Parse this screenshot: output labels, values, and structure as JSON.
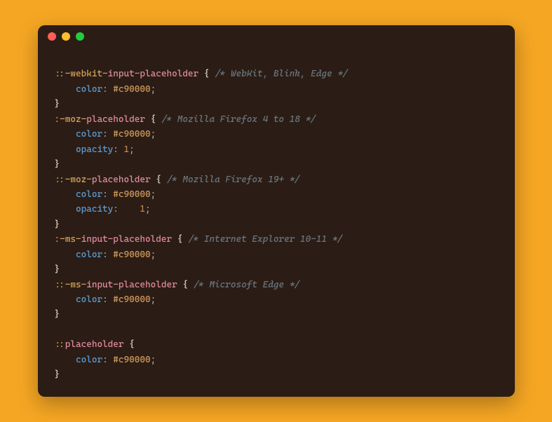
{
  "window": {
    "dots": [
      "red",
      "yellow",
      "green"
    ]
  },
  "code": {
    "lines": [
      {
        "t": "blank"
      },
      {
        "t": "sel",
        "parts": [
          "::-webkit-",
          "input-placeholder"
        ],
        "brace": " {",
        "comment": " /* WebKit, Blink, Edge */"
      },
      {
        "t": "prop",
        "indent": "    ",
        "name": "color",
        "sep": ": ",
        "value": "#c90000",
        "end": ";"
      },
      {
        "t": "close",
        "brace": "}"
      },
      {
        "t": "sel",
        "parts": [
          ":-moz-",
          "placeholder"
        ],
        "brace": " {",
        "comment": " /* Mozilla Firefox 4 to 18 */"
      },
      {
        "t": "prop",
        "indent": "    ",
        "name": "color",
        "sep": ": ",
        "value": "#c90000",
        "end": ";"
      },
      {
        "t": "propnum",
        "indent": "    ",
        "name": "opacity",
        "sep": ": ",
        "value": "1",
        "end": ";"
      },
      {
        "t": "close",
        "brace": "}"
      },
      {
        "t": "sel",
        "parts": [
          "::-moz-",
          "placeholder"
        ],
        "brace": " {",
        "comment": " /* Mozilla Firefox 19+ */"
      },
      {
        "t": "prop",
        "indent": "    ",
        "name": "color",
        "sep": ": ",
        "value": "#c90000",
        "end": ";"
      },
      {
        "t": "propnum",
        "indent": "    ",
        "name": "opacity",
        "sep": ":    ",
        "value": "1",
        "end": ";"
      },
      {
        "t": "close",
        "brace": "}"
      },
      {
        "t": "sel",
        "parts": [
          ":-ms-",
          "input-placeholder"
        ],
        "brace": " {",
        "comment": " /* Internet Explorer 10-11 */"
      },
      {
        "t": "prop",
        "indent": "    ",
        "name": "color",
        "sep": ": ",
        "value": "#c90000",
        "end": ";"
      },
      {
        "t": "close",
        "brace": "}"
      },
      {
        "t": "sel",
        "parts": [
          "::-ms-",
          "input-placeholder"
        ],
        "brace": " {",
        "comment": " /* Microsoft Edge */"
      },
      {
        "t": "prop",
        "indent": "    ",
        "name": "color",
        "sep": ": ",
        "value": "#c90000",
        "end": ";"
      },
      {
        "t": "close",
        "brace": "}"
      },
      {
        "t": "blank"
      },
      {
        "t": "sel",
        "parts": [
          "::",
          "placeholder"
        ],
        "brace": " {",
        "comment": ""
      },
      {
        "t": "prop",
        "indent": "    ",
        "name": "color",
        "sep": ": ",
        "value": "#c90000",
        "end": ";"
      },
      {
        "t": "close",
        "brace": "}"
      }
    ]
  }
}
